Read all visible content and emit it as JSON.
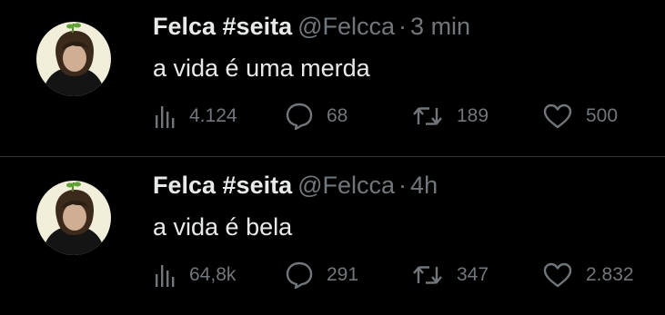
{
  "colors": {
    "background": "#000000",
    "primary_text": "#e7e9ea",
    "secondary_text": "#71767b",
    "divider": "#2f3336"
  },
  "icons": {
    "views": "bar-chart-icon",
    "reply": "speech-bubble-icon",
    "retweet": "retweet-arrows-icon",
    "like": "heart-outline-icon"
  },
  "tweets": [
    {
      "author_name": "Felca #seita",
      "handle": "@Felcca",
      "separator": "·",
      "time": "3 min",
      "text": "a vida é uma merda",
      "views": "4.124",
      "replies": "68",
      "retweets": "189",
      "likes": "500"
    },
    {
      "author_name": "Felca #seita",
      "handle": "@Felcca",
      "separator": "·",
      "time": "4h",
      "text": "a vida é bela",
      "views": "64,8k",
      "replies": "291",
      "retweets": "347",
      "likes": "2.832"
    }
  ]
}
